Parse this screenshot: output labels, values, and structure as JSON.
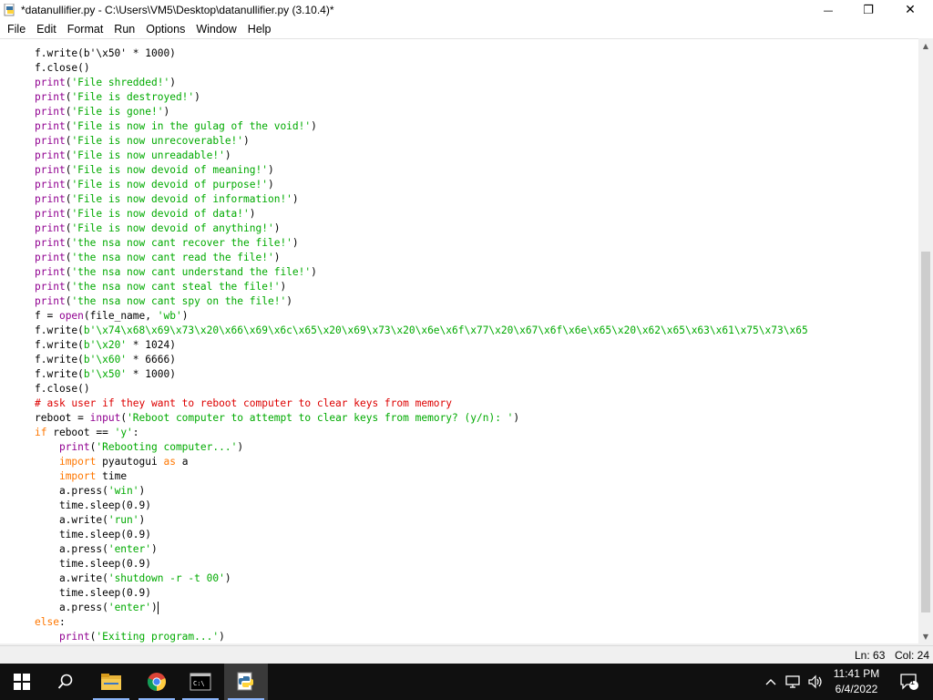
{
  "window": {
    "title": "*datanullifier.py - C:\\Users\\VM5\\Desktop\\datanullifier.py (3.10.4)*",
    "minimize_glyph": "—",
    "maximize_glyph": "❐",
    "close_glyph": "✕"
  },
  "menu": [
    "File",
    "Edit",
    "Format",
    "Run",
    "Options",
    "Window",
    "Help"
  ],
  "code": {
    "lines": [
      [
        [
          "f.write(b'\\x50' * 1000)",
          ""
        ]
      ],
      [
        [
          "f.close()",
          ""
        ]
      ],
      [
        [
          "print",
          "bi"
        ],
        [
          "(",
          ""
        ],
        [
          "'File shredded!'",
          "st"
        ],
        [
          ")",
          ""
        ]
      ],
      [
        [
          "print",
          "bi"
        ],
        [
          "(",
          ""
        ],
        [
          "'File is destroyed!'",
          "st"
        ],
        [
          ")",
          ""
        ]
      ],
      [
        [
          "print",
          "bi"
        ],
        [
          "(",
          ""
        ],
        [
          "'File is gone!'",
          "st"
        ],
        [
          ")",
          ""
        ]
      ],
      [
        [
          "print",
          "bi"
        ],
        [
          "(",
          ""
        ],
        [
          "'File is now in the gulag of the void!'",
          "st"
        ],
        [
          ")",
          ""
        ]
      ],
      [
        [
          "print",
          "bi"
        ],
        [
          "(",
          ""
        ],
        [
          "'File is now unrecoverable!'",
          "st"
        ],
        [
          ")",
          ""
        ]
      ],
      [
        [
          "print",
          "bi"
        ],
        [
          "(",
          ""
        ],
        [
          "'File is now unreadable!'",
          "st"
        ],
        [
          ")",
          ""
        ]
      ],
      [
        [
          "print",
          "bi"
        ],
        [
          "(",
          ""
        ],
        [
          "'File is now devoid of meaning!'",
          "st"
        ],
        [
          ")",
          ""
        ]
      ],
      [
        [
          "print",
          "bi"
        ],
        [
          "(",
          ""
        ],
        [
          "'File is now devoid of purpose!'",
          "st"
        ],
        [
          ")",
          ""
        ]
      ],
      [
        [
          "print",
          "bi"
        ],
        [
          "(",
          ""
        ],
        [
          "'File is now devoid of information!'",
          "st"
        ],
        [
          ")",
          ""
        ]
      ],
      [
        [
          "print",
          "bi"
        ],
        [
          "(",
          ""
        ],
        [
          "'File is now devoid of data!'",
          "st"
        ],
        [
          ")",
          ""
        ]
      ],
      [
        [
          "print",
          "bi"
        ],
        [
          "(",
          ""
        ],
        [
          "'File is now devoid of anything!'",
          "st"
        ],
        [
          ")",
          ""
        ]
      ],
      [
        [
          "print",
          "bi"
        ],
        [
          "(",
          ""
        ],
        [
          "'the nsa now cant recover the file!'",
          "st"
        ],
        [
          ")",
          ""
        ]
      ],
      [
        [
          "print",
          "bi"
        ],
        [
          "(",
          ""
        ],
        [
          "'the nsa now cant read the file!'",
          "st"
        ],
        [
          ")",
          ""
        ]
      ],
      [
        [
          "print",
          "bi"
        ],
        [
          "(",
          ""
        ],
        [
          "'the nsa now cant understand the file!'",
          "st"
        ],
        [
          ")",
          ""
        ]
      ],
      [
        [
          "print",
          "bi"
        ],
        [
          "(",
          ""
        ],
        [
          "'the nsa now cant steal the file!'",
          "st"
        ],
        [
          ")",
          ""
        ]
      ],
      [
        [
          "print",
          "bi"
        ],
        [
          "(",
          ""
        ],
        [
          "'the nsa now cant spy on the file!'",
          "st"
        ],
        [
          ")",
          ""
        ]
      ],
      [
        [
          "f = ",
          ""
        ],
        [
          "open",
          "bi"
        ],
        [
          "(file_name, ",
          ""
        ],
        [
          "'wb'",
          "st"
        ],
        [
          ")",
          ""
        ]
      ],
      [
        [
          "f.write(",
          ""
        ],
        [
          "b'\\x74\\x68\\x69\\x73\\x20\\x66\\x69\\x6c\\x65\\x20\\x69\\x73\\x20\\x6e\\x6f\\x77\\x20\\x67\\x6f\\x6e\\x65\\x20\\x62\\x65\\x63\\x61\\x75\\x73\\x65",
          "st"
        ]
      ],
      [
        [
          "f.write(",
          ""
        ],
        [
          "b'\\x20'",
          "st"
        ],
        [
          " * 1024)",
          ""
        ]
      ],
      [
        [
          "f.write(",
          ""
        ],
        [
          "b'\\x60'",
          "st"
        ],
        [
          " * 6666)",
          ""
        ]
      ],
      [
        [
          "f.write(",
          ""
        ],
        [
          "b'\\x50'",
          "st"
        ],
        [
          " * 1000)",
          ""
        ]
      ],
      [
        [
          "f.close()",
          ""
        ]
      ],
      [
        [
          "# ask user if they want to reboot computer to clear keys from memory",
          "cm"
        ]
      ],
      [
        [
          "reboot = ",
          ""
        ],
        [
          "input",
          "bi"
        ],
        [
          "(",
          ""
        ],
        [
          "'Reboot computer to attempt to clear keys from memory? (y/n): '",
          "st"
        ],
        [
          ")",
          ""
        ]
      ],
      [
        [
          "if",
          "kw"
        ],
        [
          " reboot == ",
          ""
        ],
        [
          "'y'",
          "st"
        ],
        [
          ":",
          ""
        ]
      ],
      [
        [
          "    ",
          ""
        ],
        [
          "print",
          "bi"
        ],
        [
          "(",
          ""
        ],
        [
          "'Rebooting computer...'",
          "st"
        ],
        [
          ")",
          ""
        ]
      ],
      [
        [
          "    ",
          ""
        ],
        [
          "import",
          "kw"
        ],
        [
          " pyautogui ",
          ""
        ],
        [
          "as",
          "kw"
        ],
        [
          " a",
          ""
        ]
      ],
      [
        [
          "    ",
          ""
        ],
        [
          "import",
          "kw"
        ],
        [
          " time",
          ""
        ]
      ],
      [
        [
          "    a.press(",
          ""
        ],
        [
          "'win'",
          "st"
        ],
        [
          ")",
          ""
        ]
      ],
      [
        [
          "    time.sleep(0.9)",
          ""
        ]
      ],
      [
        [
          "    a.write(",
          ""
        ],
        [
          "'run'",
          "st"
        ],
        [
          ")",
          ""
        ]
      ],
      [
        [
          "    time.sleep(0.9)",
          ""
        ]
      ],
      [
        [
          "    a.press(",
          ""
        ],
        [
          "'enter'",
          "st"
        ],
        [
          ")",
          ""
        ]
      ],
      [
        [
          "    time.sleep(0.9)",
          ""
        ]
      ],
      [
        [
          "    a.write(",
          ""
        ],
        [
          "'shutdown -r -t 00'",
          "st"
        ],
        [
          ")",
          ""
        ]
      ],
      [
        [
          "    time.sleep(0.9)",
          ""
        ]
      ],
      [
        [
          "    a.press(",
          ""
        ],
        [
          "'enter'",
          "st"
        ],
        [
          ")",
          ""
        ],
        [
          "|caret|",
          "caret"
        ]
      ],
      [
        [
          "else",
          "kw"
        ],
        [
          ":",
          ""
        ]
      ],
      [
        [
          "    ",
          ""
        ],
        [
          "print",
          "bi"
        ],
        [
          "(",
          ""
        ],
        [
          "'Exiting program...'",
          "st"
        ],
        [
          ")",
          ""
        ]
      ]
    ]
  },
  "status": {
    "line": "Ln: 63",
    "col": "Col: 24"
  },
  "taskbar": {
    "items": [
      "windows-start",
      "search",
      "file-explorer",
      "chrome",
      "terminal",
      "python-idle"
    ],
    "clock_time": "11:41 PM",
    "clock_date": "6/4/2022",
    "notification_count": "1"
  },
  "colors": {
    "keyword": "#ff7700",
    "builtin": "#900090",
    "string": "#00aa00",
    "comment": "#dd0000",
    "taskbar": "#101010"
  }
}
